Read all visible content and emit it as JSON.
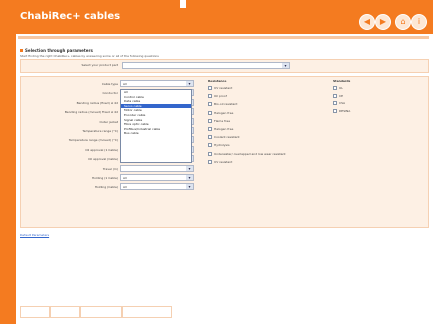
{
  "app": {
    "title": "ChabiRec+ cables"
  },
  "nav": {
    "back": "◀",
    "forward": "▶",
    "home": "⌂",
    "info": "i"
  },
  "section": {
    "title": "Selection through parameters",
    "intro": "Start finding the right ChabiRec+ cables by answering some or all of the following questions"
  },
  "type_row": {
    "label": "Select your product part",
    "value": ""
  },
  "params": [
    {
      "label": "Cable type",
      "value": "All"
    },
    {
      "label": "Conductor",
      "value": ""
    },
    {
      "label": "Bending radius (fixed) ≥ 4d",
      "value": ""
    },
    {
      "label": "Bending radius (moved) Fixed ≥ 4d",
      "value": ""
    },
    {
      "label": "Outer jacket",
      "value": ""
    },
    {
      "label": "Temperature range (°C)",
      "value": ""
    },
    {
      "label": "Temperature range (moved) (°C)",
      "value": ""
    },
    {
      "label": "Oil approval (1 Cable)",
      "value": "All"
    },
    {
      "label": "Oil approval (Cable)",
      "value": "All"
    },
    {
      "label": "Travel (m)",
      "value": ""
    },
    {
      "label": "Holding (1 Cable)",
      "value": "All"
    },
    {
      "label": "Holding (Cable)",
      "value": "All"
    }
  ],
  "dropdown_options": [
    "All",
    "Control cable",
    "Data cable",
    "Servo cable",
    "Motor cable",
    "Encoder cable",
    "Signal cable",
    "Fibre optic cable",
    "Profibus/Industrial cable",
    "Bus cable"
  ],
  "dropdown_selected_index": 3,
  "resistance": {
    "heading": "Resistance",
    "items": [
      "UV resistant",
      "Oil proof",
      "Bio-oil resistant",
      "Halogen free",
      "Flame free",
      "Halogen free",
      "Coolant resistant",
      "Hydrolysis",
      "Underwater/ overlapped and low wear resistant",
      "UV resistant"
    ]
  },
  "standards": {
    "heading": "Standards",
    "items": [
      "UL",
      "CE",
      "CSA",
      "DESINA"
    ]
  },
  "link": "Default Parameters",
  "bottom_tabs": [
    "",
    "",
    "",
    ""
  ]
}
